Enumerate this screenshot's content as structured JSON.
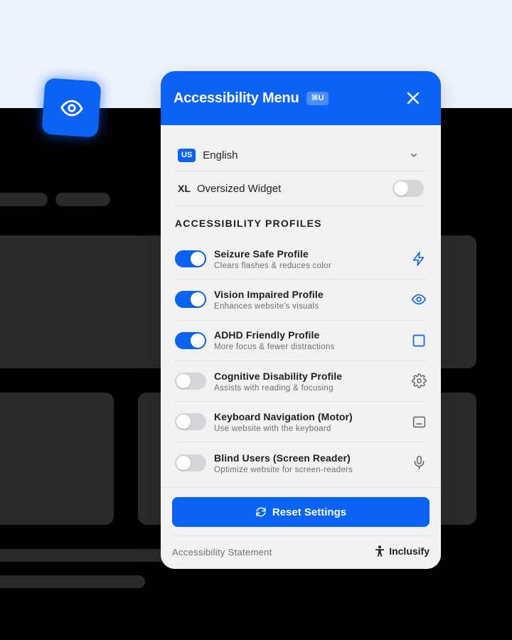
{
  "floating_button": {
    "icon": "eye-icon"
  },
  "panel": {
    "title": "Accessibility Menu",
    "shortcut": "⌘U",
    "close_icon": "close-icon"
  },
  "language": {
    "flag": "US",
    "label": "English",
    "icon": "chevron-down-icon"
  },
  "oversized": {
    "badge": "XL",
    "label": "Oversized Widget",
    "enabled": false
  },
  "profiles_section": {
    "title": "ACCESSIBILITY PROFILES",
    "items": [
      {
        "title": "Seizure Safe Profile",
        "desc": "Clears flashes & reduces color",
        "enabled": true,
        "icon": "lightning-icon"
      },
      {
        "title": "Vision Impaired Profile",
        "desc": "Enhances website's visuals",
        "enabled": true,
        "icon": "eye-icon"
      },
      {
        "title": "ADHD Friendly Profile",
        "desc": "More focus & fewer distractions",
        "enabled": true,
        "icon": "square-icon"
      },
      {
        "title": "Cognitive Disability Profile",
        "desc": "Assists with reading & focusing",
        "enabled": false,
        "icon": "gear-icon"
      },
      {
        "title": "Keyboard Navigation (Motor)",
        "desc": "Use website with the keyboard",
        "enabled": false,
        "icon": "keyboard-icon"
      },
      {
        "title": "Blind Users (Screen Reader)",
        "desc": "Optimize website for screen-readers",
        "enabled": false,
        "icon": "microphone-icon"
      }
    ]
  },
  "footer": {
    "reset_label": "Reset Settings",
    "statement": "Accessibility Statement",
    "brand": "Inclusify"
  },
  "colors": {
    "accent": "#0b63f6",
    "toggle_off": "#d6d6da",
    "panel_bg": "#f2f2f3",
    "page_dark": "#000000",
    "page_light": "#eff4fc"
  }
}
